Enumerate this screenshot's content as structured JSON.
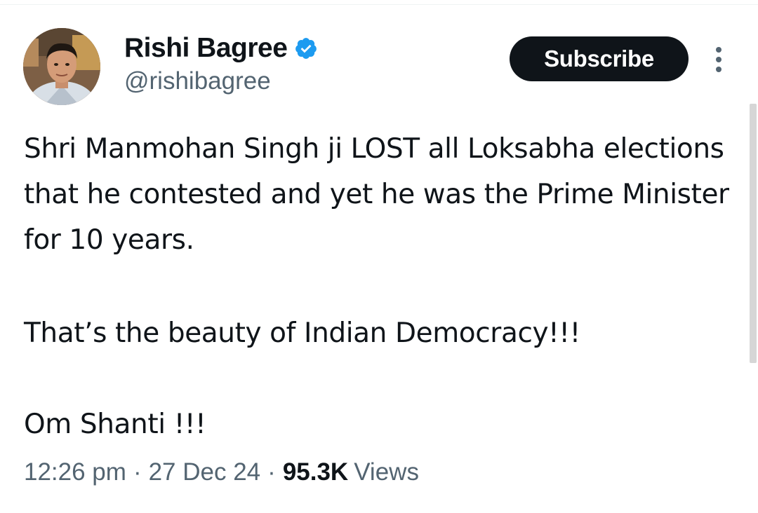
{
  "author": {
    "display_name": "Rishi Bagree",
    "handle": "@rishibagree",
    "verified": true
  },
  "actions": {
    "subscribe_label": "Subscribe"
  },
  "tweet": {
    "paragraph_1": "Shri Manmohan Singh ji LOST all Loksabha elections that he contested and yet he was the Prime Minister for 10 years.",
    "paragraph_2": "That’s the beauty of Indian Democracy!!!",
    "paragraph_3": "Om Shanti !!!"
  },
  "meta": {
    "time": "12:26 pm",
    "separator": "·",
    "date": "27 Dec 24",
    "views_count": "95.3K",
    "views_label": "Views"
  },
  "colors": {
    "text_primary": "#0f1419",
    "text_secondary": "#536471",
    "verified_blue": "#1d9bf0",
    "button_bg": "#0f1419"
  },
  "icons": [
    "verified-badge-icon",
    "more-options-icon"
  ]
}
